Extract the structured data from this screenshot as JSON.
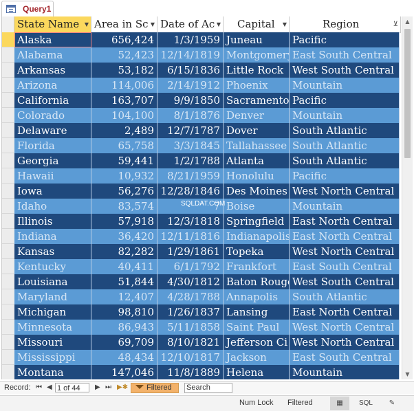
{
  "tab": {
    "title": "Query1",
    "icon": "query-datasheet-icon"
  },
  "columns": [
    {
      "label": "State Name"
    },
    {
      "label": "Area in Sc"
    },
    {
      "label": "Date of Ac"
    },
    {
      "label": "Capital"
    },
    {
      "label": "Region"
    }
  ],
  "rows": [
    {
      "state": "Alaska",
      "area": "656,424",
      "date": "1/3/1959",
      "capital": "Juneau",
      "region": "Pacific"
    },
    {
      "state": "Alabama",
      "area": "52,423",
      "date": "12/14/1819",
      "capital": "Montgomery",
      "region": "East South Central"
    },
    {
      "state": "Arkansas",
      "area": "53,182",
      "date": "6/15/1836",
      "capital": "Little Rock",
      "region": "West South Central"
    },
    {
      "state": "Arizona",
      "area": "114,006",
      "date": "2/14/1912",
      "capital": "Phoenix",
      "region": "Mountain"
    },
    {
      "state": "California",
      "area": "163,707",
      "date": "9/9/1850",
      "capital": "Sacramento",
      "region": "Pacific"
    },
    {
      "state": "Colorado",
      "area": "104,100",
      "date": "8/1/1876",
      "capital": "Denver",
      "region": "Mountain"
    },
    {
      "state": "Delaware",
      "area": "2,489",
      "date": "12/7/1787",
      "capital": "Dover",
      "region": "South Atlantic"
    },
    {
      "state": "Florida",
      "area": "65,758",
      "date": "3/3/1845",
      "capital": "Tallahassee",
      "region": "South Atlantic"
    },
    {
      "state": "Georgia",
      "area": "59,441",
      "date": "1/2/1788",
      "capital": "Atlanta",
      "region": "South Atlantic"
    },
    {
      "state": "Hawaii",
      "area": "10,932",
      "date": "8/21/1959",
      "capital": "Honolulu",
      "region": "Pacific"
    },
    {
      "state": "Iowa",
      "area": "56,276",
      "date": "12/28/1846",
      "capital": "Des Moines",
      "region": "West North Central"
    },
    {
      "state": "Idaho",
      "area": "83,574",
      "date": "7",
      "capital": "Boise",
      "region": "Mountain"
    },
    {
      "state": "Illinois",
      "area": "57,918",
      "date": "12/3/1818",
      "capital": "Springfield",
      "region": "East North Central"
    },
    {
      "state": "Indiana",
      "area": "36,420",
      "date": "12/11/1816",
      "capital": "Indianapolis",
      "region": "East North Central"
    },
    {
      "state": "Kansas",
      "area": "82,282",
      "date": "1/29/1861",
      "capital": "Topeka",
      "region": "West North Central"
    },
    {
      "state": "Kentucky",
      "area": "40,411",
      "date": "6/1/1792",
      "capital": "Frankfort",
      "region": "East South Central"
    },
    {
      "state": "Louisiana",
      "area": "51,844",
      "date": "4/30/1812",
      "capital": "Baton Rouge",
      "region": "West South Central"
    },
    {
      "state": "Maryland",
      "area": "12,407",
      "date": "4/28/1788",
      "capital": "Annapolis",
      "region": "South Atlantic"
    },
    {
      "state": "Michigan",
      "area": "98,810",
      "date": "1/26/1837",
      "capital": "Lansing",
      "region": "East North Central"
    },
    {
      "state": "Minnesota",
      "area": "86,943",
      "date": "5/11/1858",
      "capital": "Saint Paul",
      "region": "West North Central"
    },
    {
      "state": "Missouri",
      "area": "69,709",
      "date": "8/10/1821",
      "capital": "Jefferson Ci",
      "region": "West North Central"
    },
    {
      "state": "Mississippi",
      "area": "48,434",
      "date": "12/10/1817",
      "capital": "Jackson",
      "region": "East South Central"
    },
    {
      "state": "Montana",
      "area": "147,046",
      "date": "11/8/1889",
      "capital": "Helena",
      "region": "Mountain"
    }
  ],
  "watermark": "SQLDAT.COM",
  "record_nav": {
    "label": "Record:",
    "position": "1 of 44",
    "filter_label": "Filtered",
    "search_label": "Search"
  },
  "status": {
    "num_lock": "Num Lock",
    "filtered": "Filtered",
    "sql_label": "SQL"
  },
  "colors": {
    "row_dark": "#1f497d",
    "row_light": "#5b9bd5",
    "header_selected": "#fbd85d",
    "tab_title": "#a4262c",
    "filter_badge": "#f3b26b"
  }
}
